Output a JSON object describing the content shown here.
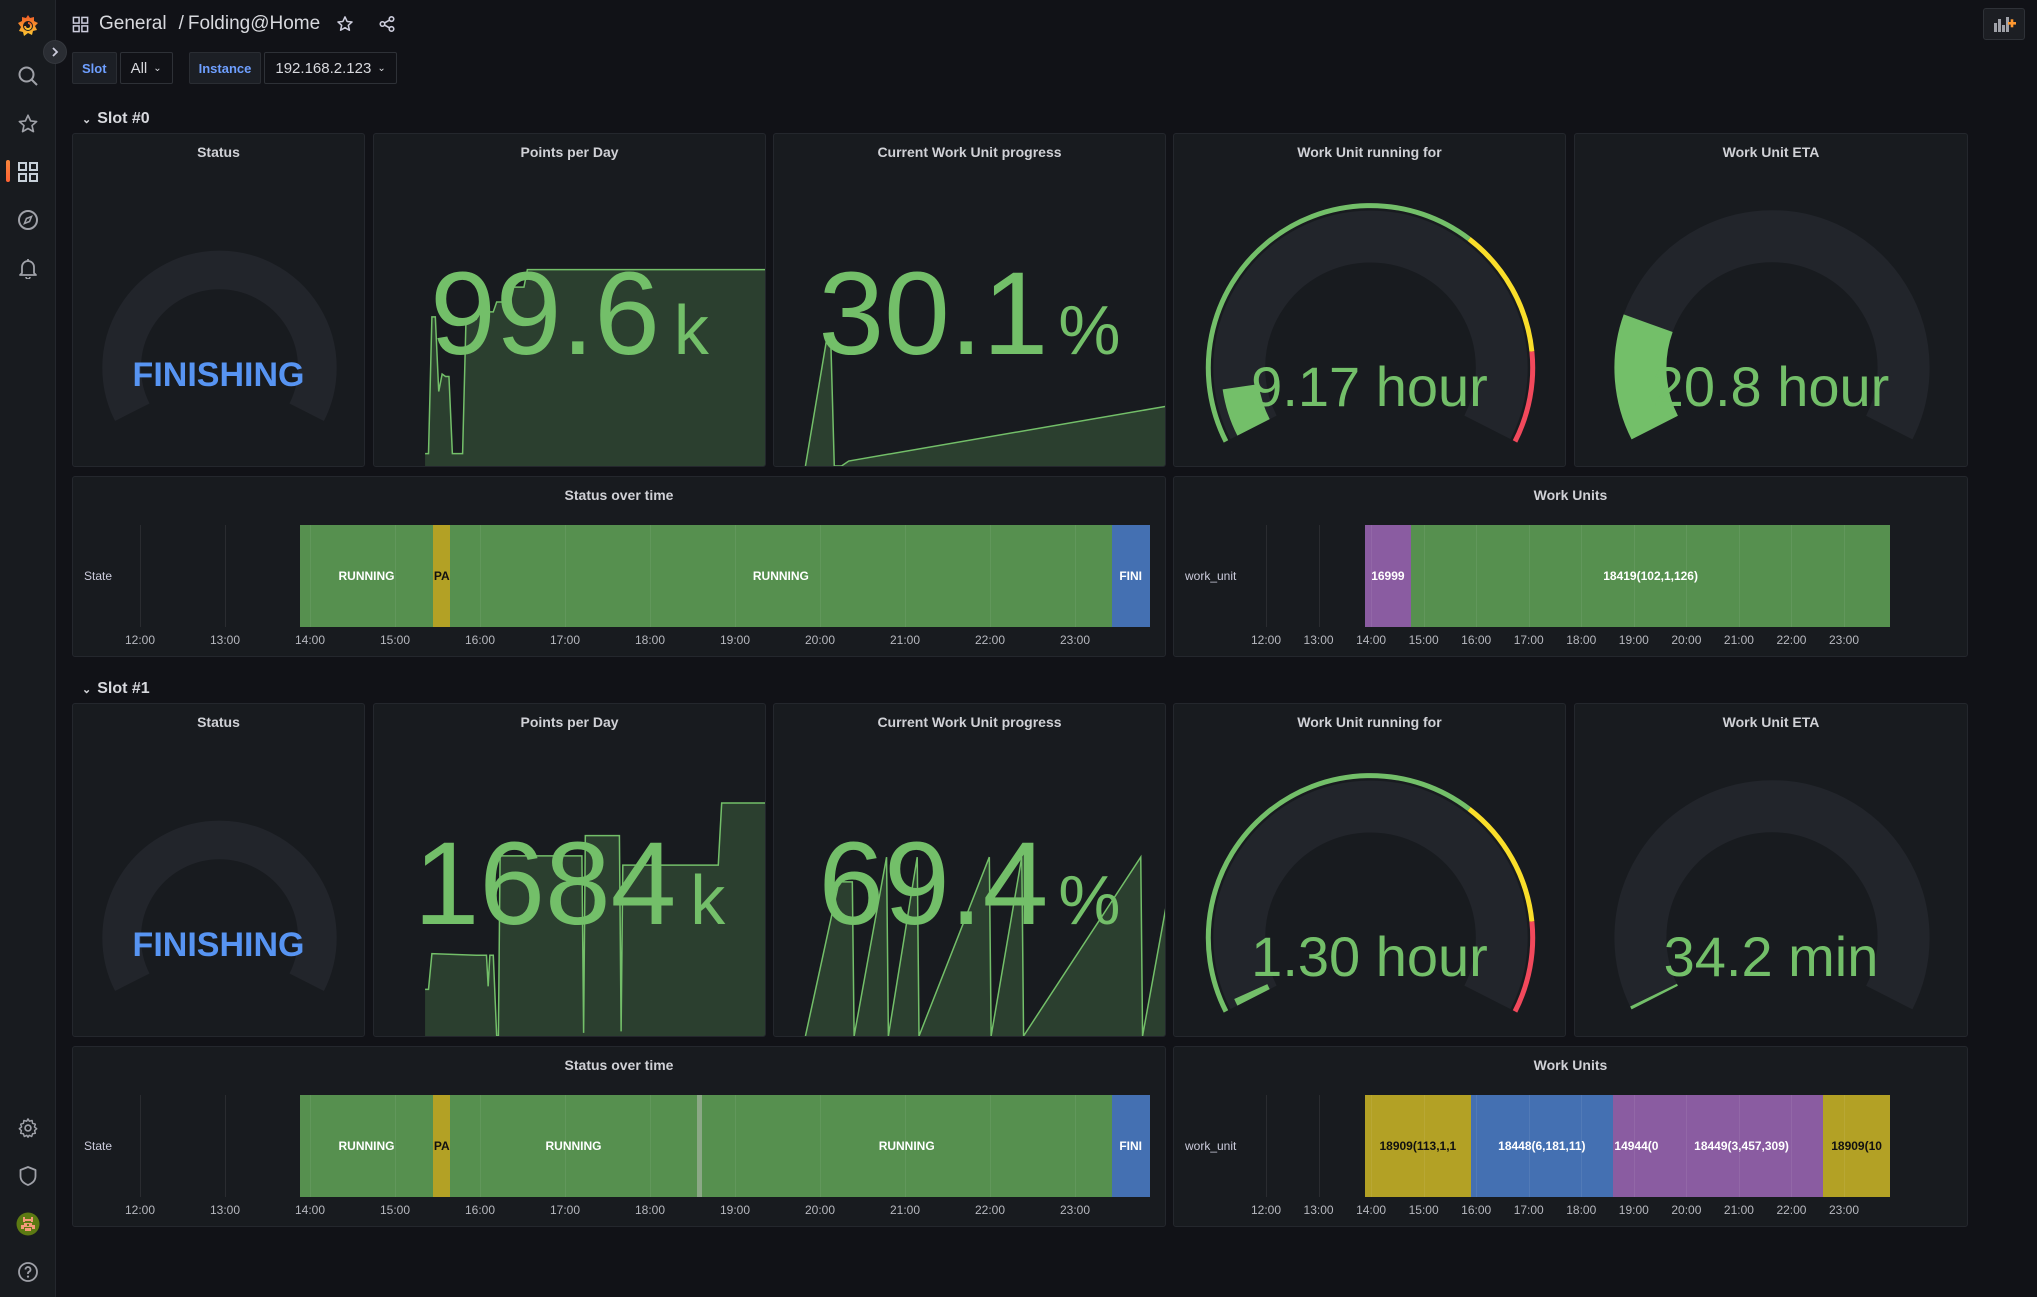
{
  "header": {
    "folder": "General",
    "separator": "/",
    "title": "Folding@Home"
  },
  "variables": [
    {
      "label": "Slot",
      "value": "All"
    },
    {
      "label": "Instance",
      "value": "192.168.2.123"
    }
  ],
  "sidebar": {
    "items": [
      {
        "name": "grafana-logo-icon"
      },
      {
        "name": "search-icon"
      },
      {
        "name": "starred-icon"
      },
      {
        "name": "dashboards-icon",
        "active": true
      },
      {
        "name": "explore-compass-icon"
      },
      {
        "name": "alerting-bell-icon"
      }
    ],
    "bottom": [
      {
        "name": "configuration-gear-icon"
      },
      {
        "name": "server-admin-shield-icon"
      },
      {
        "name": "user-avatar"
      },
      {
        "name": "help-icon"
      }
    ]
  },
  "colors": {
    "green": "#73bf69",
    "running": "#56904f",
    "paused": "#b3a125",
    "finishing": "#4470b2",
    "purple": "#8a5ca1",
    "finishing_text": "#5794f2",
    "yellow": "#fade2a",
    "red": "#f2495c",
    "gauge_bg": "#22252b"
  },
  "time_axis": [
    "12:00",
    "13:00",
    "14:00",
    "15:00",
    "16:00",
    "17:00",
    "18:00",
    "19:00",
    "20:00",
    "21:00",
    "22:00",
    "23:00"
  ],
  "slots": [
    {
      "title": "Slot #0",
      "status": {
        "title": "Status",
        "value": "FINISHING"
      },
      "ppd": {
        "title": "Points per Day",
        "value": "99.6",
        "unit": "k",
        "spark": [
          [
            0.0,
            0.05
          ],
          [
            0.01,
            0.05
          ],
          [
            0.02,
            0.6
          ],
          [
            0.03,
            0.6
          ],
          [
            0.04,
            0.3
          ],
          [
            0.05,
            0.37
          ],
          [
            0.06,
            0.36
          ],
          [
            0.07,
            0.36
          ],
          [
            0.08,
            0.05
          ],
          [
            0.1,
            0.05
          ],
          [
            0.11,
            0.05
          ],
          [
            0.12,
            0.59
          ],
          [
            0.15,
            0.59
          ],
          [
            0.16,
            0.62
          ],
          [
            0.2,
            0.62
          ],
          [
            0.21,
            0.66
          ],
          [
            0.25,
            0.66
          ],
          [
            0.26,
            0.72
          ],
          [
            0.29,
            0.72
          ],
          [
            0.3,
            0.79
          ],
          [
            0.7,
            0.79
          ],
          [
            1.0,
            0.79
          ]
        ]
      },
      "progress": {
        "title": "Current Work Unit progress",
        "value": "30.1",
        "unit": "%",
        "spark": [
          [
            0.0,
            0.0
          ],
          [
            0.06,
            0.52
          ],
          [
            0.07,
            0.52
          ],
          [
            0.08,
            0.0
          ],
          [
            0.1,
            0.0
          ],
          [
            0.12,
            0.02
          ],
          [
            1.0,
            0.24
          ]
        ]
      },
      "running": {
        "title": "Work Unit running for",
        "value": "9.17 hour",
        "fraction": 0.08
      },
      "eta": {
        "title": "Work Unit ETA",
        "value": "20.8 hour",
        "fraction": 0.2
      },
      "status_timeline": {
        "title": "Status over time",
        "row_label": "State",
        "segments": [
          {
            "label": "RUNNING",
            "start": 13.88,
            "end": 15.45,
            "state": "running"
          },
          {
            "label": "PA",
            "start": 15.45,
            "end": 15.65,
            "state": "paused"
          },
          {
            "label": "RUNNING",
            "start": 15.65,
            "end": 23.43,
            "state": "running"
          },
          {
            "label": "FINI",
            "start": 23.43,
            "end": 23.88,
            "state": "finishing"
          }
        ]
      },
      "work_units": {
        "title": "Work Units",
        "row_label": "work_unit",
        "segments": [
          {
            "label": "16999",
            "start": 13.88,
            "end": 14.76,
            "color": "purple"
          },
          {
            "label": "18419(102,1,126)",
            "start": 14.76,
            "end": 23.88,
            "color": "running"
          }
        ]
      }
    },
    {
      "title": "Slot #1",
      "status": {
        "title": "Status",
        "value": "FINISHING"
      },
      "ppd": {
        "title": "Points per Day",
        "value": "1684",
        "unit": "k",
        "spark": [
          [
            0.0,
            0.3
          ],
          [
            0.01,
            0.3
          ],
          [
            0.02,
            0.53
          ],
          [
            0.15,
            0.52
          ],
          [
            0.18,
            0.52
          ],
          [
            0.185,
            0.32
          ],
          [
            0.19,
            0.52
          ],
          [
            0.2,
            0.52
          ],
          [
            0.21,
            0.0
          ],
          [
            0.215,
            0.0
          ],
          [
            0.22,
            1.16
          ],
          [
            0.46,
            1.16
          ],
          [
            0.465,
            0.02
          ],
          [
            0.47,
            1.29
          ],
          [
            0.57,
            1.29
          ],
          [
            0.575,
            0.03
          ],
          [
            0.58,
            1.1
          ],
          [
            0.86,
            1.1
          ],
          [
            0.87,
            1.5
          ],
          [
            1.0,
            1.5
          ]
        ]
      },
      "progress": {
        "title": "Current Work Unit progress",
        "value": "69.4",
        "unit": "%",
        "spark": [
          [
            0.0,
            0.0
          ],
          [
            0.03,
            0.2
          ],
          [
            0.09,
            0.6
          ],
          [
            0.1,
            0.62
          ],
          [
            0.13,
            0.62
          ],
          [
            0.135,
            0.0
          ],
          [
            0.225,
            0.72
          ],
          [
            0.23,
            0.0
          ],
          [
            0.31,
            0.72
          ],
          [
            0.315,
            0.0
          ],
          [
            0.51,
            0.72
          ],
          [
            0.515,
            0.0
          ],
          [
            0.6,
            0.72
          ],
          [
            0.605,
            0.0
          ],
          [
            0.93,
            0.72
          ],
          [
            0.935,
            0.0
          ],
          [
            1.0,
            0.52
          ]
        ]
      },
      "running": {
        "title": "Work Unit running for",
        "value": "1.30 hour",
        "fraction": 0.012
      },
      "eta": {
        "title": "Work Unit ETA",
        "value": "34.2 min",
        "fraction": 0.005
      },
      "status_timeline": {
        "title": "Status over time",
        "row_label": "State",
        "segments": [
          {
            "label": "RUNNING",
            "start": 13.88,
            "end": 15.45,
            "state": "running"
          },
          {
            "label": "PA",
            "start": 15.45,
            "end": 15.65,
            "state": "paused"
          },
          {
            "label": "RUNNING",
            "start": 15.65,
            "end": 18.55,
            "state": "running"
          },
          {
            "label": "",
            "start": 18.55,
            "end": 18.61,
            "state": "gap"
          },
          {
            "label": "RUNNING",
            "start": 18.61,
            "end": 23.43,
            "state": "running"
          },
          {
            "label": "FINI",
            "start": 23.43,
            "end": 23.88,
            "state": "finishing"
          }
        ]
      },
      "work_units": {
        "title": "Work Units",
        "row_label": "work_unit",
        "segments": [
          {
            "label": "18909(113,1,1",
            "start": 13.88,
            "end": 15.9,
            "color": "paused"
          },
          {
            "label": "18448(6,181,11)",
            "start": 15.9,
            "end": 18.6,
            "color": "finishing"
          },
          {
            "label": "14944(0",
            "start": 18.6,
            "end": 19.5,
            "color": "purple"
          },
          {
            "label": "18449(3,457,309)",
            "start": 19.5,
            "end": 22.6,
            "color": "purple"
          },
          {
            "label": "18909(10",
            "start": 22.6,
            "end": 23.88,
            "color": "paused"
          }
        ]
      }
    }
  ]
}
